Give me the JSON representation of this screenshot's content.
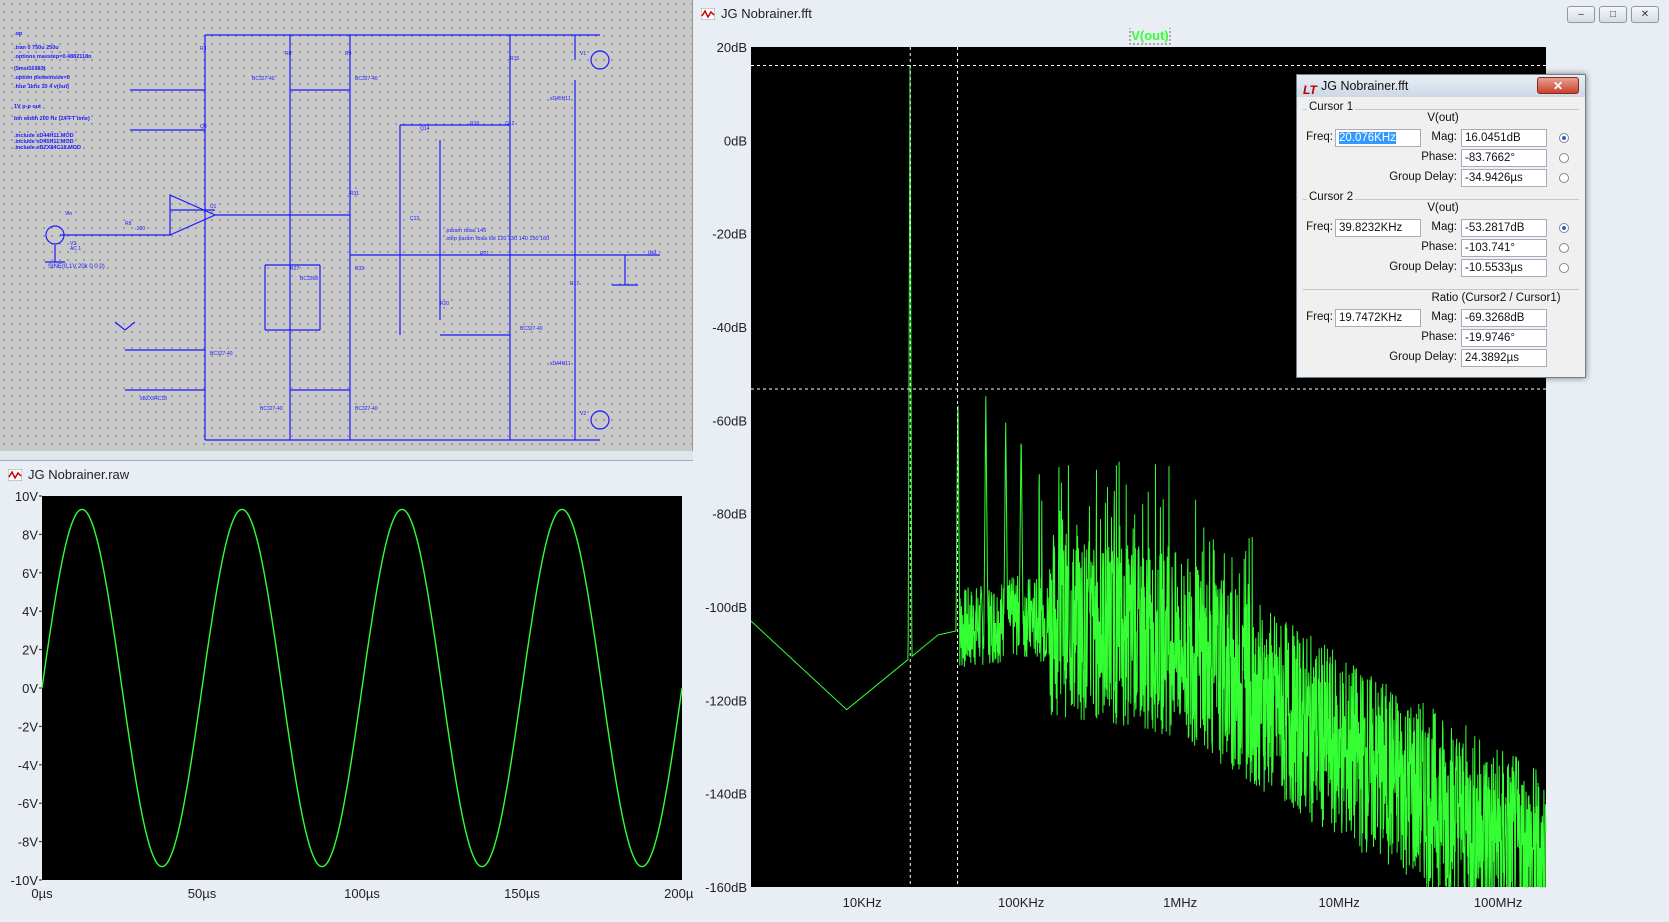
{
  "schematic": {
    "directives": [
      ".op",
      ".tran 0 750u 250u",
      ".options maxstep=0.4882118n",
      "(5ms/16383)",
      ".option plotwinsize=0",
      ".four 1khz 10 4 v(out)",
      "1V p-p out",
      "bin width 200 Hz (2/FFT time)",
      ".include xD44H11.MOD",
      ".include xD45H11.MOD",
      ".include xBZX84C18.MOD"
    ],
    "source_label": "SINE(0.1V 20k 0 0 0)",
    "param_text": ".param rbias 145",
    "step_text": ".step param rbias list 120 130 140 150 160",
    "out_label": "out"
  },
  "raw_window": {
    "title": "JG Nobrainer.raw",
    "y_ticks": [
      "10V",
      "8V",
      "6V",
      "4V",
      "2V",
      "0V",
      "-2V",
      "-4V",
      "-6V",
      "-8V",
      "-10V"
    ],
    "x_ticks": [
      "0µs",
      "50µs",
      "100µs",
      "150µs",
      "200µs"
    ]
  },
  "fft_window": {
    "title": "JG Nobrainer.fft",
    "trace_label": "V(out)",
    "y_ticks": [
      "20dB",
      "0dB",
      "-20dB",
      "-40dB",
      "-60dB",
      "-80dB",
      "-100dB",
      "-120dB",
      "-140dB",
      "-160dB"
    ],
    "x_ticks": [
      "10KHz",
      "100KHz",
      "1MHz",
      "10MHz",
      "100MHz"
    ]
  },
  "cursor_dialog": {
    "title": "JG Nobrainer.fft",
    "cursor1": {
      "label": "Cursor 1",
      "trace": "V(out)",
      "freq": "20.076KHz",
      "mag": "16.0451dB",
      "phase": "-83.7662°",
      "group_delay": "-34.9426µs"
    },
    "cursor2": {
      "label": "Cursor 2",
      "trace": "V(out)",
      "freq": "39.8232KHz",
      "mag": "-53.2817dB",
      "phase": "-103.741°",
      "group_delay": "-10.5533µs"
    },
    "ratio": {
      "label": "Ratio (Cursor2 / Cursor1)",
      "freq": "19.7472KHz",
      "mag": "-69.3268dB",
      "phase": "-19.9746°",
      "group_delay": "24.3892µs"
    },
    "labels": {
      "freq": "Freq:",
      "mag": "Mag:",
      "phase": "Phase:",
      "group_delay": "Group Delay:"
    }
  },
  "colors": {
    "trace": "#33ff33",
    "schematic_wire": "#1a1aff",
    "plot_bg": "#000000"
  },
  "chart_data": [
    {
      "type": "line",
      "title": "",
      "xlabel": "",
      "ylabel": "",
      "series": [
        {
          "name": "",
          "description_values": "sine, amplitude 9.3V, period 50µs"
        }
      ],
      "x_range_us": [
        0,
        200
      ],
      "ylim": [
        -10,
        10
      ],
      "amplitude": 9.3,
      "period_us": 50
    },
    {
      "type": "line",
      "xlabel": "",
      "ylabel": "",
      "series": [
        {
          "name": "V(out)"
        }
      ],
      "x_scale": "log",
      "xlim_hz": [
        2000,
        200000000
      ],
      "ylim": [
        -160,
        20
      ],
      "peaks": [
        {
          "x": 20000,
          "y": 16
        },
        {
          "x": 40000,
          "y": -53
        },
        {
          "x": 60000,
          "y": -54
        },
        {
          "x": 80000,
          "y": -60
        },
        {
          "x": 100000,
          "y": -62
        }
      ],
      "noise_floor": [
        {
          "x": 2000,
          "y": -103
        },
        {
          "x": 8000,
          "y": -122
        },
        {
          "x": 30000,
          "y": -106
        },
        {
          "x": 100000,
          "y": -102
        },
        {
          "x": 1000000,
          "y": -108
        },
        {
          "x": 10000000,
          "y": -130
        },
        {
          "x": 200000000,
          "y": -155
        }
      ],
      "cursor1": {
        "x": 20076,
        "y": 16.0451
      },
      "cursor2": {
        "x": 39823.2,
        "y": -53.2817
      }
    }
  ]
}
